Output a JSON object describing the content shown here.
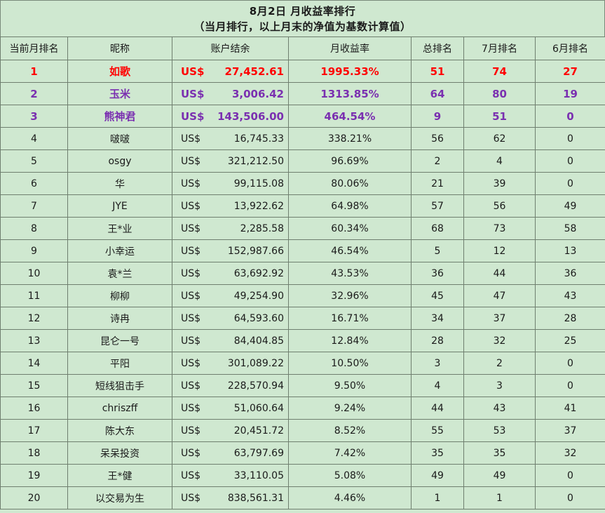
{
  "title": "8月2日 月收益率排行",
  "subtitle": "（当月排行，以上月末的净值为基数计算值）",
  "headers": [
    "当前月排名",
    "昵称",
    "账户结余",
    "月收益率",
    "总排名",
    "7月排名",
    "6月排名"
  ],
  "currency": "US$",
  "colors": {
    "background": "#cfe8d0",
    "rank1": "#ff0000",
    "rank2_3": "#7a2fb0",
    "border": "#6f7f6f"
  },
  "rows": [
    {
      "rank": "1",
      "name": "如歌",
      "balance": "27,452.61",
      "rate": "1995.33%",
      "total": "51",
      "jul": "74",
      "jun": "27"
    },
    {
      "rank": "2",
      "name": "玉米",
      "balance": "3,006.42",
      "rate": "1313.85%",
      "total": "64",
      "jul": "80",
      "jun": "19"
    },
    {
      "rank": "3",
      "name": "熊神君",
      "balance": "143,506.00",
      "rate": "464.54%",
      "total": "9",
      "jul": "51",
      "jun": "0"
    },
    {
      "rank": "4",
      "name": "啵啵",
      "balance": "16,745.33",
      "rate": "338.21%",
      "total": "56",
      "jul": "62",
      "jun": "0"
    },
    {
      "rank": "5",
      "name": "osgy",
      "balance": "321,212.50",
      "rate": "96.69%",
      "total": "2",
      "jul": "4",
      "jun": "0"
    },
    {
      "rank": "6",
      "name": "华",
      "balance": "99,115.08",
      "rate": "80.06%",
      "total": "21",
      "jul": "39",
      "jun": "0"
    },
    {
      "rank": "7",
      "name": "JYE",
      "balance": "13,922.62",
      "rate": "64.98%",
      "total": "57",
      "jul": "56",
      "jun": "49"
    },
    {
      "rank": "8",
      "name": "王*业",
      "balance": "2,285.58",
      "rate": "60.34%",
      "total": "68",
      "jul": "73",
      "jun": "58"
    },
    {
      "rank": "9",
      "name": "小幸运",
      "balance": "152,987.66",
      "rate": "46.54%",
      "total": "5",
      "jul": "12",
      "jun": "13"
    },
    {
      "rank": "10",
      "name": "袁*兰",
      "balance": "63,692.92",
      "rate": "43.53%",
      "total": "36",
      "jul": "44",
      "jun": "36"
    },
    {
      "rank": "11",
      "name": "柳柳",
      "balance": "49,254.90",
      "rate": "32.96%",
      "total": "45",
      "jul": "47",
      "jun": "43"
    },
    {
      "rank": "12",
      "name": "诗冉",
      "balance": "64,593.60",
      "rate": "16.71%",
      "total": "34",
      "jul": "37",
      "jun": "28"
    },
    {
      "rank": "13",
      "name": "昆仑一号",
      "balance": "84,404.85",
      "rate": "12.84%",
      "total": "28",
      "jul": "32",
      "jun": "25"
    },
    {
      "rank": "14",
      "name": "平阳",
      "balance": "301,089.22",
      "rate": "10.50%",
      "total": "3",
      "jul": "2",
      "jun": "0"
    },
    {
      "rank": "15",
      "name": "短线狙击手",
      "balance": "228,570.94",
      "rate": "9.50%",
      "total": "4",
      "jul": "3",
      "jun": "0"
    },
    {
      "rank": "16",
      "name": "chriszff",
      "balance": "51,060.64",
      "rate": "9.24%",
      "total": "44",
      "jul": "43",
      "jun": "41"
    },
    {
      "rank": "17",
      "name": "陈大东",
      "balance": "20,451.72",
      "rate": "8.52%",
      "total": "55",
      "jul": "53",
      "jun": "37"
    },
    {
      "rank": "18",
      "name": "呆呆投资",
      "balance": "63,797.69",
      "rate": "7.42%",
      "total": "35",
      "jul": "35",
      "jun": "32"
    },
    {
      "rank": "19",
      "name": "王*健",
      "balance": "33,110.05",
      "rate": "5.08%",
      "total": "49",
      "jul": "49",
      "jun": "0"
    },
    {
      "rank": "20",
      "name": "以交易为生",
      "balance": "838,561.31",
      "rate": "4.46%",
      "total": "1",
      "jul": "1",
      "jun": "0"
    }
  ]
}
